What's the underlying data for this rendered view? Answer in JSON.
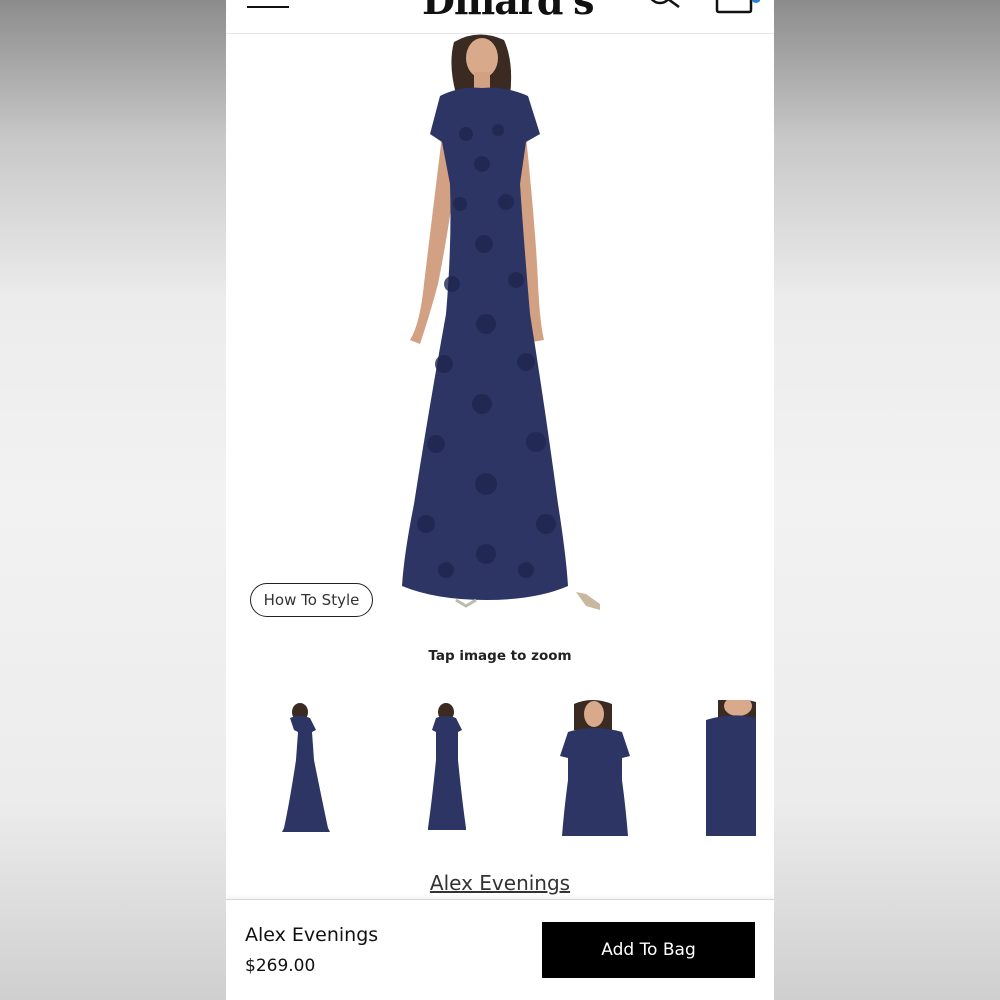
{
  "header": {
    "logo_text": "Dillard's",
    "icons": [
      "menu-icon",
      "search-icon",
      "shopping-bag-icon"
    ]
  },
  "product": {
    "how_to_style_label": "How To Style",
    "zoom_hint": "Tap image to zoom",
    "thumbnail_count_visible": 4,
    "brand_link": "Alex Evenings",
    "dress_color": "#2c3564"
  },
  "bottom_bar": {
    "brand": "Alex Evenings",
    "price": "$269.00",
    "add_to_bag_label": "Add To Bag"
  },
  "colors": {
    "button_bg": "#000000",
    "button_text": "#ffffff",
    "badge": "#2a7fd4"
  }
}
